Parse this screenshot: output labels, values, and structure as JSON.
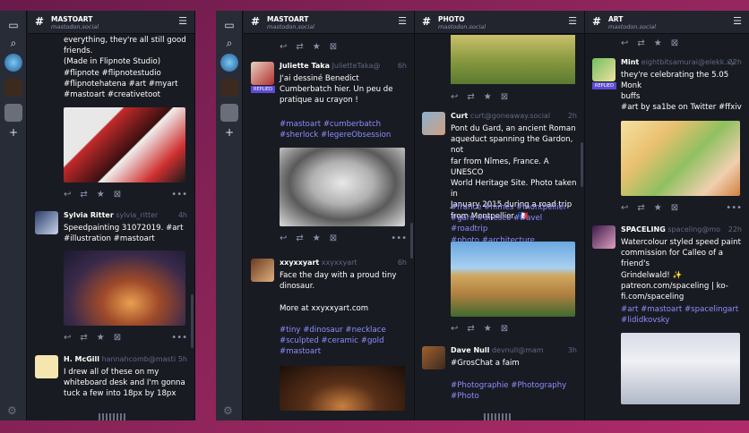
{
  "window1": {
    "rail": {
      "icons": [
        "compose-icon",
        "search-icon",
        "account-avatar",
        "notifications-icon",
        "avatar-2",
        "plus-icon",
        "settings-icon"
      ]
    },
    "column": {
      "title": "MASTOART",
      "subtitle": "mastodon.social",
      "posts": [
        {
          "text": "everything, they're all still good friends.\n(Made in Flipnote Studio)\n#flipnote #flipnotestudio\n#flipnotehatena #art #myart\n#mastoart #creativetoot"
        },
        {
          "name": "Sylvia Ritter",
          "handle": "sylvia_ritter",
          "time": "4h",
          "text": "Speedpainting 31072019. #art\n#illustration #mastoart"
        },
        {
          "name": "H. McGill",
          "handle": "hannahcomb@masti",
          "time": "5h",
          "text": "I drew all of these on my\nwhiteboard desk and I'm gonna\ntuck a few into 18px by 18px"
        }
      ]
    }
  },
  "window2": {
    "columns": [
      {
        "title": "MASTOART",
        "subtitle": "mastodon.social",
        "posts": [
          {
            "name": "Juliette Taka",
            "handle": "JulietteTaka@",
            "time": "6h",
            "badge": "REPLIED",
            "text": "J'ai dessiné Benedict\nCumberbatch hier. Un peu de\npratique au crayon !",
            "tags": "#mastoart #cumberbatch\n#sherlock #legereObsession"
          },
          {
            "name": "xxyxxyart",
            "handle": "xxyxxyart",
            "time": "6h",
            "text": "Face the day with a proud tiny\ndinosaur.",
            "more": "More at xxyxxyart.com",
            "tags": "#tiny #dinosaur #necklace\n#sculpted #ceramic #gold\n#mastoart"
          }
        ]
      },
      {
        "title": "PHOTO",
        "subtitle": "mastodon.social",
        "posts": [
          {
            "name": "Curt",
            "handle": "curt@goneaway.social",
            "time": "2h",
            "text": "Pont du Gard, an ancient Roman\naqueduct spanning the Gardon, not\nfar from Nîmes, France. A UNESCO\nWorld Heritage Site. Photo taken in\nJanuary 2015 during a road trip\nfrom Montpellier. 🇫🇷",
            "tags": "#france #nimes #montpellier\n#gard #unesco #travel #roadtrip\n#photo #architecture #engineering"
          },
          {
            "name": "Dave Null",
            "handle": "devnull@mam",
            "time": "3h",
            "text": "#GrosChat a faim",
            "tags": "#Photographie #Photography\n#Photo"
          }
        ]
      },
      {
        "title": "ART",
        "subtitle": "mastodon.social",
        "posts": [
          {
            "name": "Mint",
            "handle": "eightbitsamurai@elekk.xy",
            "time": "22h",
            "badge": "REPLIED",
            "text": "they're celebrating the 5.05 Monk\nbuffs",
            "tags": "#art by sa1be on Twitter #ffxiv"
          },
          {
            "name": "SPACELING",
            "handle": "spaceling@mo",
            "time": "22h",
            "text": "Watercolour styled speed paint\ncommission for Calleo of a friend's\nGrindelwald! ✨\npatreon.com/spaceling | ko-\nfi.com/spaceling",
            "tags": "#art #mastoart #spacelingart\n#lididkovsky"
          }
        ]
      }
    ]
  },
  "actions": {
    "reply": "↩",
    "boost": "⇄",
    "fav": "★",
    "hide": "⊠",
    "more": "•••"
  }
}
